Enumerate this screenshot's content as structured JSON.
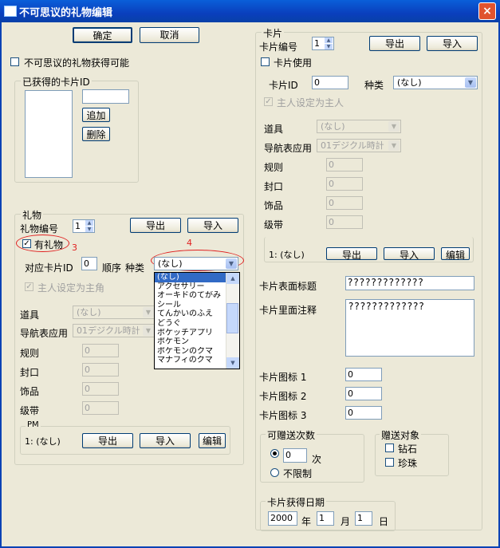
{
  "window": {
    "title": "不可思议的礼物编辑",
    "close": "×"
  },
  "top": {
    "ok": "确定",
    "cancel": "取消",
    "chk_possible": "不可思议的礼物获得可能"
  },
  "obtained": {
    "title": "已获得的卡片ID",
    "add": "追加",
    "delete": "删除"
  },
  "gift": {
    "title": "礼物",
    "number_label": "礼物编号",
    "number_value": "1",
    "export": "导出",
    "import": "导入",
    "has_gift": "有礼物",
    "note3": "3",
    "note4": "4",
    "card_id_label": "对应卡片ID",
    "card_id_value": "0",
    "order_label": "顺序",
    "kind_label": "种类",
    "kind_value": "(なし)",
    "chk_master": "主人设定为主角",
    "item_label": "道具",
    "item_value": "(なし)",
    "nav_label": "导航表应用",
    "nav_value": "01デジクル時計",
    "rule_label": "规则",
    "rule_value": "0",
    "seal_label": "封口",
    "seal_value": "0",
    "deco_label": "饰品",
    "deco_value": "0",
    "ribbon_label": "级带",
    "ribbon_value": "0",
    "pm_title": "PM",
    "pm_text": "1: (なし)",
    "pm_export": "导出",
    "pm_import": "导入",
    "pm_edit": "编辑",
    "dropdown": [
      "(なし)",
      "アクセサリー",
      "オーキドのてがみ",
      "シール",
      "てんかいのふえ",
      "どうぐ",
      "ポケッチアプリ",
      "ポケモン",
      "ポケモンのクマ",
      "マナフィのクマ"
    ]
  },
  "card": {
    "title": "卡片",
    "number_label": "卡片编号",
    "number_value": "1",
    "export": "导出",
    "import": "导入",
    "use": "卡片使用",
    "id_label": "卡片ID",
    "id_value": "0",
    "kind_label": "种类",
    "kind_value": "(なし)",
    "chk_master": "主人设定为主人",
    "item_label": "道具",
    "item_value": "(なし)",
    "nav_label": "导航表应用",
    "nav_value": "01デジクル時計",
    "rule_label": "规则",
    "rule_value": "0",
    "seal_label": "封口",
    "seal_value": "0",
    "deco_label": "饰品",
    "deco_value": "0",
    "ribbon_label": "级带",
    "ribbon_value": "0",
    "pm_text": "1: (なし)",
    "pm_export": "导出",
    "pm_import": "导入",
    "pm_edit": "编辑",
    "face_title_label": "卡片表面标题",
    "face_title_value": "?????????????",
    "back_note_label": "卡片里面注释",
    "back_note_value": "?????????????",
    "icon1_label": "卡片图标 1",
    "icon1_value": "0",
    "icon2_label": "卡片图标 2",
    "icon2_value": "0",
    "icon3_label": "卡片图标 3",
    "icon3_value": "0",
    "send_title": "可赠送次数",
    "send_value": "0",
    "send_unit": "次",
    "unlimited": "不限制",
    "target_title": "赠送对象",
    "diamond": "钻石",
    "pearl": "珍珠",
    "date_title": "卡片获得日期",
    "year_value": "2000",
    "year": "年",
    "month_value": "1",
    "month": "月",
    "day_value": "1",
    "day": "日"
  }
}
